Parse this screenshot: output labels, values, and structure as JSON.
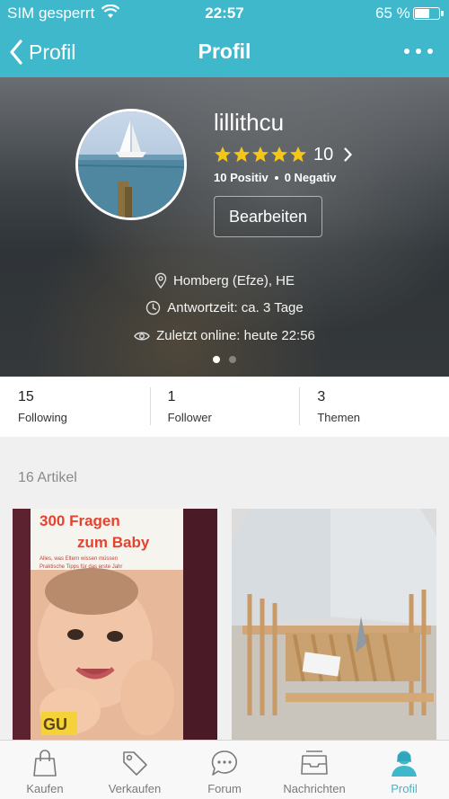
{
  "status_bar": {
    "carrier": "SIM gesperrt",
    "time": "22:57",
    "battery": "65 %",
    "battery_level": 0.65
  },
  "nav": {
    "back_label": "Profil",
    "title": "Profil"
  },
  "profile": {
    "username": "lillithcu",
    "rating_stars": 5,
    "rating_count": "10",
    "positive": "10 Positiv",
    "negative": "0 Negativ",
    "edit_label": "Bearbeiten",
    "location": "Homberg (Efze), HE",
    "response_time": "Antwortzeit: ca. 3 Tage",
    "last_online": "Zuletzt online: heute 22:56",
    "pager": {
      "pages": 2,
      "active": 0
    }
  },
  "stats": [
    {
      "value": "15",
      "label": "Following"
    },
    {
      "value": "1",
      "label": "Follower"
    },
    {
      "value": "3",
      "label": "Themen"
    }
  ],
  "articles": {
    "count_label": "16 Artikel",
    "book": {
      "title_line1": "300 Fragen",
      "title_line2": "zum Baby",
      "bullet1": "Alles, was Eltern wissen müssen",
      "bullet2": "Praktische Tipps für das erste Jahr",
      "publisher": "GU"
    }
  },
  "tabs": [
    {
      "label": "Kaufen",
      "icon": "shopping-bag-icon"
    },
    {
      "label": "Verkaufen",
      "icon": "price-tag-icon"
    },
    {
      "label": "Forum",
      "icon": "chat-bubble-icon"
    },
    {
      "label": "Nachrichten",
      "icon": "inbox-icon"
    },
    {
      "label": "Profil",
      "icon": "user-icon",
      "active": true
    }
  ],
  "colors": {
    "accent": "#3fb8cc",
    "star": "#f5c518",
    "tab_inactive": "#7a7a7a"
  }
}
